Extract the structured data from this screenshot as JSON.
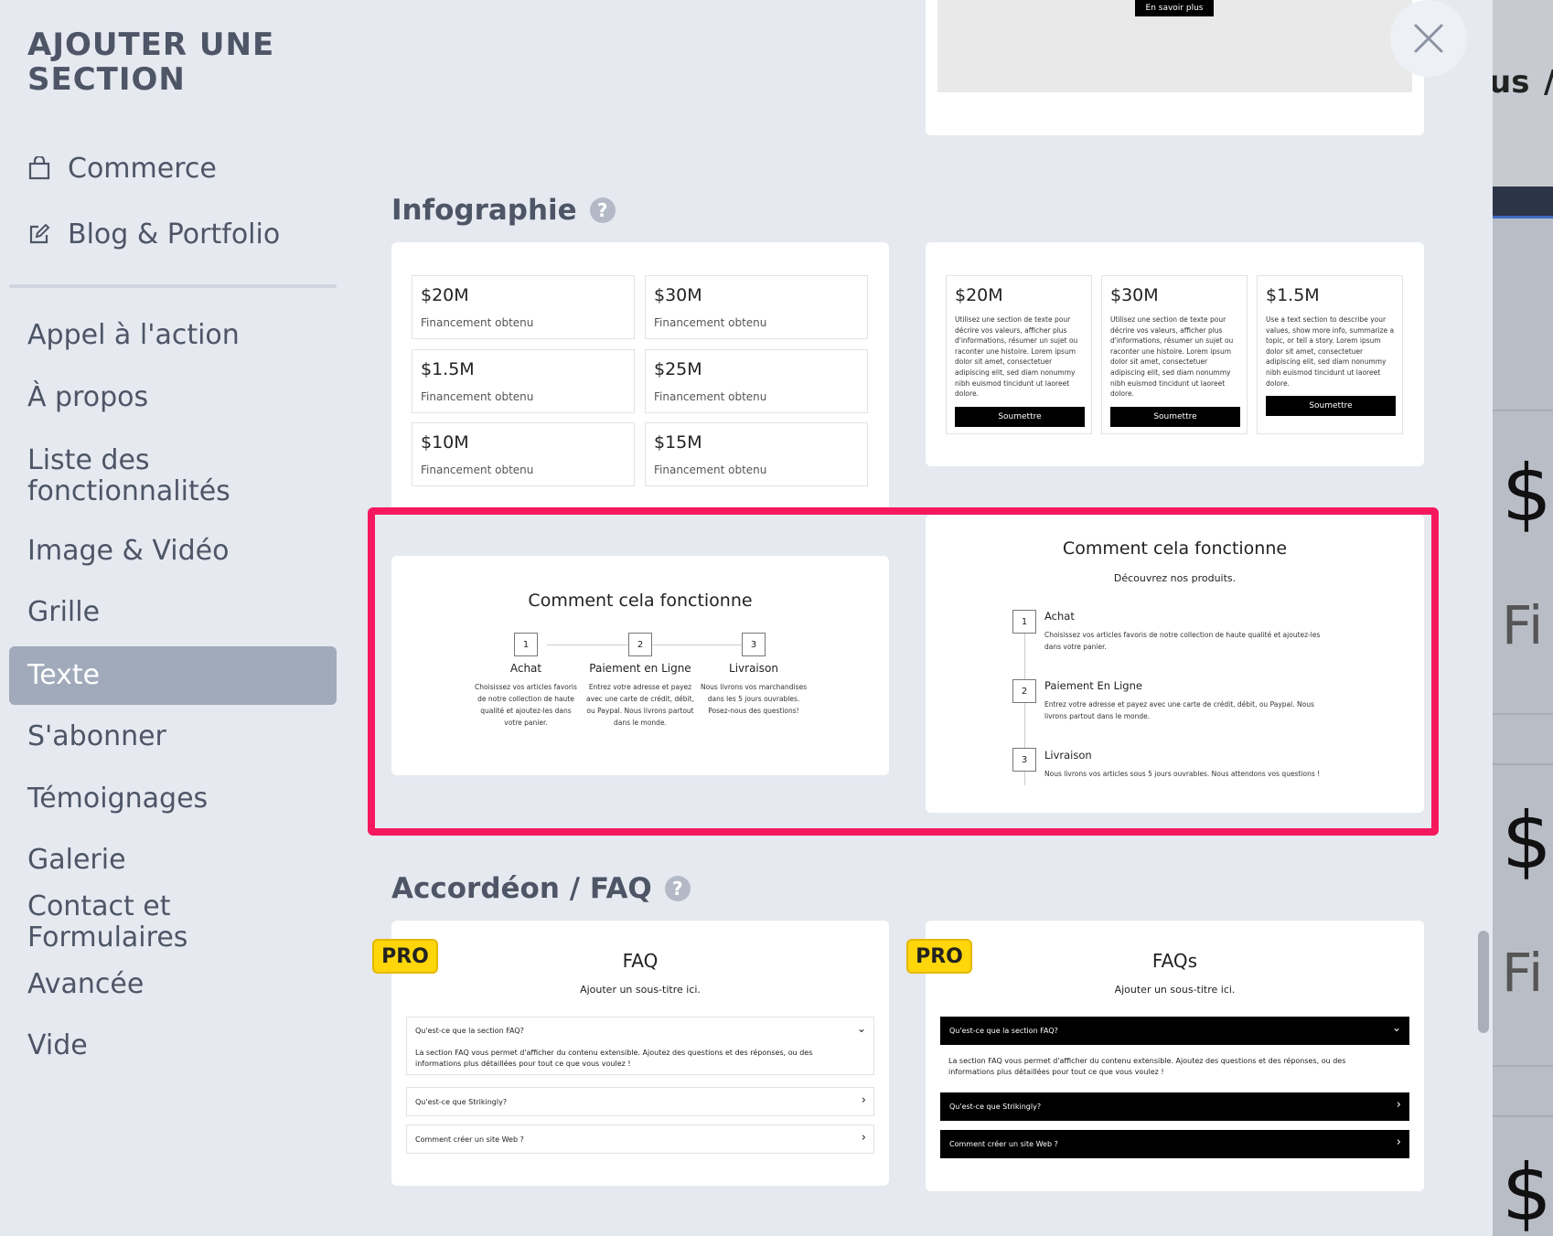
{
  "sidebar": {
    "title": "AJOUTER UNE SECTION",
    "top_items": [
      {
        "label": "Commerce",
        "icon": "shopping-bag-icon"
      },
      {
        "label": "Blog & Portfolio",
        "icon": "edit-icon"
      }
    ],
    "categories": [
      {
        "label": "Appel à l'action"
      },
      {
        "label": "À propos"
      },
      {
        "label": "Liste des fonctionnalités"
      },
      {
        "label": "Image & Vidéo"
      },
      {
        "label": "Grille"
      },
      {
        "label": "Texte",
        "active": true
      },
      {
        "label": "S'abonner"
      },
      {
        "label": "Témoignages"
      },
      {
        "label": "Galerie"
      },
      {
        "label": "Contact et Formulaires"
      },
      {
        "label": "Avancée"
      },
      {
        "label": "Vide"
      }
    ]
  },
  "top_card": {
    "button_label": "En savoir plus"
  },
  "sections": {
    "infographie": {
      "title": "Infographie",
      "help": "?"
    },
    "accordeon": {
      "title": "Accordéon / FAQ",
      "help": "?"
    }
  },
  "infographic_stats": {
    "items": [
      {
        "value": "$20M",
        "label": "Financement obtenu"
      },
      {
        "value": "$30M",
        "label": "Financement obtenu"
      },
      {
        "value": "$1.5M",
        "label": "Financement obtenu"
      },
      {
        "value": "$25M",
        "label": "Financement obtenu"
      },
      {
        "value": "$10M",
        "label": "Financement obtenu"
      },
      {
        "value": "$15M",
        "label": "Financement obtenu"
      }
    ]
  },
  "infographic_cols": {
    "items": [
      {
        "value": "$20M",
        "text": "Utilisez une section de texte pour décrire vos valeurs, afficher plus d'informations, résumer un sujet ou raconter une histoire. Lorem ipsum dolor sit amet, consectetuer adipiscing elit, sed diam nonummy nibh euismod tincidunt ut laoreet dolore.",
        "button": "Soumettre"
      },
      {
        "value": "$30M",
        "text": "Utilisez une section de texte pour décrire vos valeurs, afficher plus d'informations, résumer un sujet ou raconter une histoire. Lorem ipsum dolor sit amet, consectetuer adipiscing elit, sed diam nonummy nibh euismod tincidunt ut laoreet dolore.",
        "button": "Soumettre"
      },
      {
        "value": "$1.5M",
        "text": "Use a text section to describe your values, show more info, summarize a topic, or tell a story. Lorem ipsum dolor sit amet, consectetuer adipiscing elit, sed diam nonummy nibh euismod tincidunt ut laoreet dolore.",
        "button": "Soumettre"
      }
    ]
  },
  "how_it_works_h": {
    "title": "Comment cela fonctionne",
    "steps": [
      {
        "num": "1",
        "title": "Achat",
        "text": "Choisissez vos articles favoris de notre collection de haute qualité et ajoutez-les dans votre panier."
      },
      {
        "num": "2",
        "title": "Paiement en Ligne",
        "text": "Entrez votre adresse et payez avec une carte de crédit, débit, ou Paypal. Nous livrons partout dans le monde."
      },
      {
        "num": "3",
        "title": "Livraison",
        "text": "Nous livrons vos marchandises dans les 5 jours ouvrables. Posez-nous des questions!"
      }
    ]
  },
  "how_it_works_v": {
    "title": "Comment cela fonctionne",
    "subtitle": "Découvrez nos produits.",
    "steps": [
      {
        "num": "1",
        "title": "Achat",
        "text": "Choisissez vos articles favoris de notre collection de haute qualité et ajoutez-les dans votre panier."
      },
      {
        "num": "2",
        "title": "Paiement En Ligne",
        "text": "Entrez votre adresse et payez avec une carte de crédit, débit, ou Paypal. Nous livrons partout dans le monde."
      },
      {
        "num": "3",
        "title": "Livraison",
        "text": "Nous livrons vos articles sous 5 jours ouvrables. Nous attendons vos questions !"
      }
    ]
  },
  "faq_light": {
    "badge": "PRO",
    "title": "FAQ",
    "subtitle": "Ajouter un sous-titre ici.",
    "rows": [
      {
        "q": "Qu'est-ce que la section FAQ?",
        "a": "La section FAQ vous permet d'afficher du contenu extensible. Ajoutez des questions et des réponses, ou des informations plus détaillées pour tout ce que vous voulez !",
        "chevron": "⌄"
      },
      {
        "q": "Qu'est-ce que Strikingly?",
        "chevron": "›"
      },
      {
        "q": "Comment créer un site Web ?",
        "chevron": "›"
      }
    ]
  },
  "faq_dark": {
    "badge": "PRO",
    "title": "FAQs",
    "subtitle": "Ajouter un sous-titre ici.",
    "rows": [
      {
        "q": "Qu'est-ce que la section FAQ?",
        "a": "La section FAQ vous permet d'afficher du contenu extensible. Ajoutez des questions et des réponses, ou des informations plus détaillées pour tout ce que vous voulez !",
        "chevron": "⌄"
      },
      {
        "q": "Qu'est-ce que Strikingly?",
        "chevron": "›"
      },
      {
        "q": "Comment créer un site Web ?",
        "chevron": "›"
      }
    ]
  },
  "background_page": {
    "fragments": [
      "us",
      "/",
      "$",
      "Fi",
      "$",
      "Fi",
      "$"
    ]
  },
  "close": {
    "icon": "close-icon"
  }
}
